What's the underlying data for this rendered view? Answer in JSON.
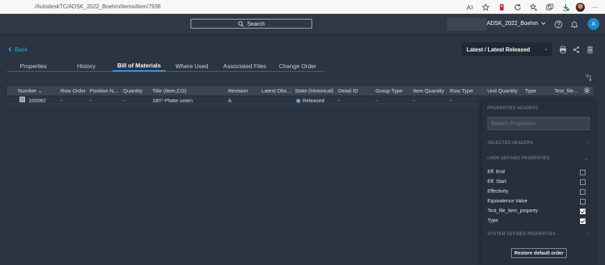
{
  "browser": {
    "url": "/AutodeskTC/ADSK_2022_Boehm/items/item/7938",
    "icons": [
      "read-aloud-icon",
      "add-favorite-icon",
      "extension-icon",
      "refresh-icon",
      "favorites-icon",
      "collections-icon",
      "downloads-icon",
      "profile-icon",
      "more-icon"
    ],
    "more_label": "···"
  },
  "header": {
    "search_label": "Search",
    "tenant": "ADSK_2022_Boehm",
    "avatar_initial": "A"
  },
  "toolbar": {
    "back_label": "Back",
    "version_label": "Latest / Latest Released"
  },
  "tabs": [
    {
      "label": "Properties"
    },
    {
      "label": "History"
    },
    {
      "label": "Bill of Materials",
      "active": true
    },
    {
      "label": "Where Used"
    },
    {
      "label": "Associated Files"
    },
    {
      "label": "Change Order"
    }
  ],
  "table": {
    "columns": [
      "Number",
      "Row Order",
      "Position N...",
      "Quantity",
      "Title (Item,CO)",
      "Revision",
      "Latest Obs...",
      "State (Historical)",
      "Detail ID",
      "Group Type",
      "Item Quantity",
      "Row Type",
      "Unit Quantity",
      "Type",
      "Test_file..."
    ],
    "rows": [
      {
        "number": "100082",
        "row_order": "-",
        "position": "-",
        "quantity": "-",
        "title": "180°-Platte unten",
        "revision": "A",
        "state": "Released",
        "detail_id": "-",
        "group_type": "-",
        "item_quantity": "-",
        "row_type": "-"
      }
    ]
  },
  "panel": {
    "properties_headers": "PROPERTIES HEADERS",
    "search_placeholder": "Search Properties",
    "selected_headers": "SELECTED HEADERS",
    "user_defined": "USER DEFINED PROPERTIES",
    "properties": [
      {
        "label": "Eff. End",
        "checked": false
      },
      {
        "label": "Eff. Start",
        "checked": false
      },
      {
        "label": "Effectivity",
        "checked": false
      },
      {
        "label": "Equivalence Value",
        "checked": false
      },
      {
        "label": "Test_file_item_property",
        "checked": true
      },
      {
        "label": "Type",
        "checked": true
      }
    ],
    "system_defined": "SYSTEM DEFINED PROPERTIES",
    "restore_label": "Restore default order"
  },
  "colors": {
    "accent": "#3aa4e8",
    "background": "#2b3441",
    "state_released": "#68a6dc"
  }
}
